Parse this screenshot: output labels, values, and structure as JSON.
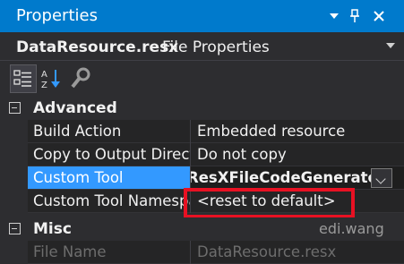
{
  "window": {
    "title": "Properties",
    "buttons": [
      "▾",
      "📌",
      "✕"
    ]
  },
  "object": {
    "name": "DataResource.resx",
    "type": "File Properties"
  },
  "toolbar": {
    "items": [
      "categorized-icon",
      "alphabetical-icon",
      "property-pages-icon"
    ]
  },
  "categories": [
    {
      "label": "Advanced",
      "properties": [
        {
          "name": "Build Action",
          "value": "Embedded resource"
        },
        {
          "name": "Copy to Output Directory",
          "value": "Do not copy"
        },
        {
          "name": "Custom Tool",
          "value": "ResXFileCodeGenerator",
          "selected": true
        },
        {
          "name": "Custom Tool Namespace",
          "value": "<reset to default>"
        }
      ]
    },
    {
      "label": "Misc",
      "properties": [
        {
          "name": "File Name",
          "value": "DataResource.resx"
        }
      ]
    }
  ],
  "watermark": "edi.wang",
  "colors": {
    "accent": "#007acc",
    "selection": "#3399ff",
    "highlight_box": "#e81123",
    "background": "#2d2d30"
  }
}
